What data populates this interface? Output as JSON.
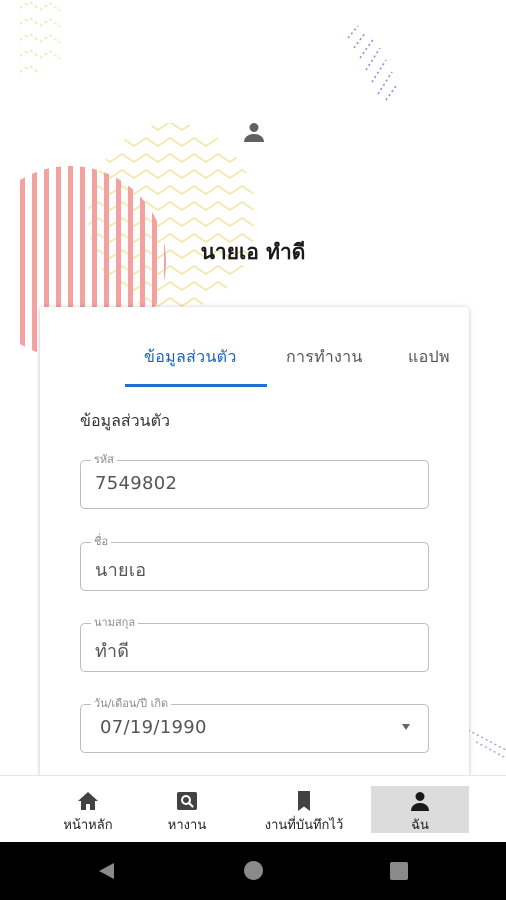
{
  "profile": {
    "name": "นายเอ ทำดี"
  },
  "tabs": [
    {
      "label": "ข้อมูลส่วนตัว",
      "active": true
    },
    {
      "label": "การทำงาน",
      "active": false
    },
    {
      "label": "แอปพ",
      "active": false
    }
  ],
  "personal": {
    "section_title": "ข้อมูลส่วนตัว",
    "fields": [
      {
        "label": "รหัส",
        "value": "7549802"
      },
      {
        "label": "ชื่อ",
        "value": "นายเอ"
      },
      {
        "label": "นามสกุล",
        "value": "ทำดี"
      },
      {
        "label": "วัน/เดือน/ปี เกิด",
        "value": "07/19/1990"
      }
    ]
  },
  "bottom_nav": [
    {
      "label": "หน้าหลัก",
      "icon": "home-icon",
      "active": false
    },
    {
      "label": "หางาน",
      "icon": "search-icon",
      "active": false
    },
    {
      "label": "งานที่บันทึกไว้",
      "icon": "bookmark-icon",
      "active": false
    },
    {
      "label": "ฉัน",
      "icon": "person-icon",
      "active": true
    }
  ],
  "colors": {
    "accent": "#1e6fd6",
    "deco_red": "#f08080",
    "deco_yellow": "#efe4a0",
    "deco_blue": "#7f86d6",
    "active_nav_bg": "#dcdcdc"
  },
  "system_nav": [
    "back-icon",
    "home-circle-icon",
    "recents-icon"
  ]
}
